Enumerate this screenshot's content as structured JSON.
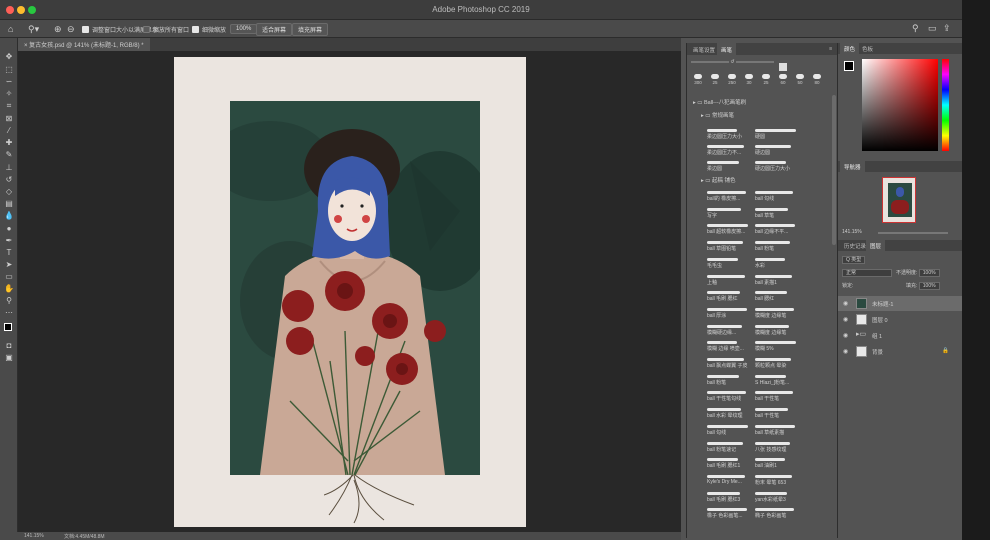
{
  "app": {
    "title": "Adobe Photoshop CC 2019"
  },
  "options_bar": {
    "zoom_all_windows": "调整窗口大小以满屏显示",
    "scroll_all": "缩放所有窗口",
    "scrubby_zoom": "细微缩放",
    "zoom_value": "100%",
    "fit_screen": "适合屏幕",
    "fill_screen": "填充屏幕"
  },
  "document": {
    "tab_label": "复古女孩.psd @ 141% (未标题-1, RGB/8) *"
  },
  "status": {
    "zoom": "141.15%",
    "doc_size": "文档:4.45M/48.8M"
  },
  "brush_panel": {
    "tabs": [
      "画笔设置",
      "画笔"
    ],
    "size_presets": [
      "300",
      "25",
      "250",
      "30",
      "25",
      "60",
      "50",
      "80"
    ],
    "groups": [
      {
        "label": "Ball---八犯画笔刷"
      },
      {
        "label": "常规画笔"
      },
      {
        "label": "起稿 铺色"
      }
    ],
    "brushes": [
      [
        "柔边圆压力大小",
        "硬圆"
      ],
      [
        "柔边圆压力不...",
        "硬边圆"
      ],
      [
        "柔边圆",
        "硬边圆压力大小"
      ],
      [
        "ball的 橡皮擦...",
        "ball 勾线"
      ],
      [
        "写字",
        "ball 草笔"
      ],
      [
        "ball 超软橡皮擦...",
        "ball 边缘不平..."
      ],
      [
        "ball 草图铅笔",
        "ball 粉笔"
      ],
      [
        "毛毛虫",
        "水彩"
      ],
      [
        "上釉",
        "ball 素描1"
      ],
      [
        "ball 毛刷 腮红",
        "ball 腮红"
      ],
      [
        "ball 厚涂",
        "模糊度 边缘笔"
      ],
      [
        "模糊硬边缘...",
        "模糊度 边缘笔"
      ],
      [
        "模糊 边缘 喷壶...",
        "模糊 5%"
      ],
      [
        "ball 飘点蝶翼 子皮",
        "颗粒颗点 晕染"
      ],
      [
        "ball 粉笔",
        "S Hlazi_[粉笔..."
      ],
      [
        "ball 干性笔勾线",
        "ball 干性笔"
      ],
      [
        "ball 水彩 晕纹理",
        "ball 干性笔"
      ],
      [
        "ball 勾线",
        "ball 草纸素描"
      ],
      [
        "ball 粉笔速记",
        "八张 技感纹理"
      ],
      [
        "ball 毛刷 腮红1",
        "ball 油刷1"
      ],
      [
        "Kyle's Dry Me...",
        "粉末 晕笔 653"
      ],
      [
        "ball 毛刷 腮红3",
        "yan水彩纸晕3"
      ],
      [
        "橡子 色彩画笔...",
        "椭子 色彩画笔"
      ]
    ]
  },
  "color_panel": {
    "tabs": [
      "颜色",
      "色板"
    ]
  },
  "navigator": {
    "title": "导航器",
    "zoom": "141.15%"
  },
  "layers_panel": {
    "tabs": [
      "历史记录",
      "图层"
    ],
    "filter": "Q 类型",
    "blend_mode": "正常",
    "opacity_label": "不透明度:",
    "opacity_value": "100%",
    "lock_label": "锁定:",
    "fill_label": "填充:",
    "fill_value": "100%",
    "layers": [
      {
        "name": "未标题-1",
        "selected": true
      },
      {
        "name": "图层 0",
        "selected": false
      },
      {
        "name": "组 1",
        "selected": false
      },
      {
        "name": "背景",
        "selected": false
      }
    ]
  },
  "colors": {
    "accent_blue": "#3b58a8",
    "flower_red": "#8c1e1e"
  }
}
